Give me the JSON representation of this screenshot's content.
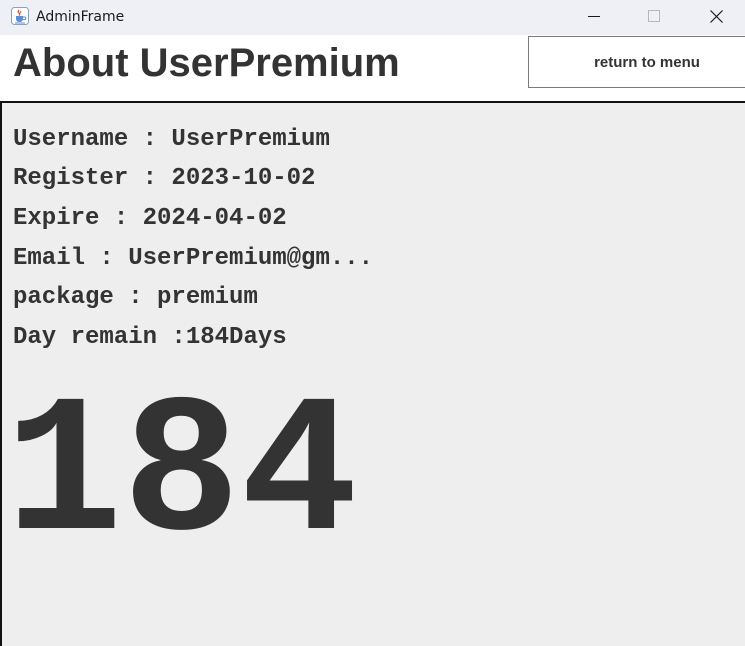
{
  "window": {
    "title": "AdminFrame",
    "icon": "java-cup-icon",
    "controls": [
      "minimize-icon",
      "maximize-icon",
      "close-icon"
    ]
  },
  "header": {
    "title": "About UserPremium",
    "return_button_label": "return to menu"
  },
  "info": {
    "username": "Username : UserPremium",
    "register": "Register : 2023-10-02",
    "expire": "Expire : 2024-04-02",
    "email": "Email : UserPremium@gm...",
    "package": "package : premium",
    "day_remain": "Day remain :184Days"
  },
  "big_counter": "184",
  "colors": {
    "titlebar_bg": "#eff0f5",
    "panel_bg": "#eeeeee",
    "text": "#333333"
  }
}
